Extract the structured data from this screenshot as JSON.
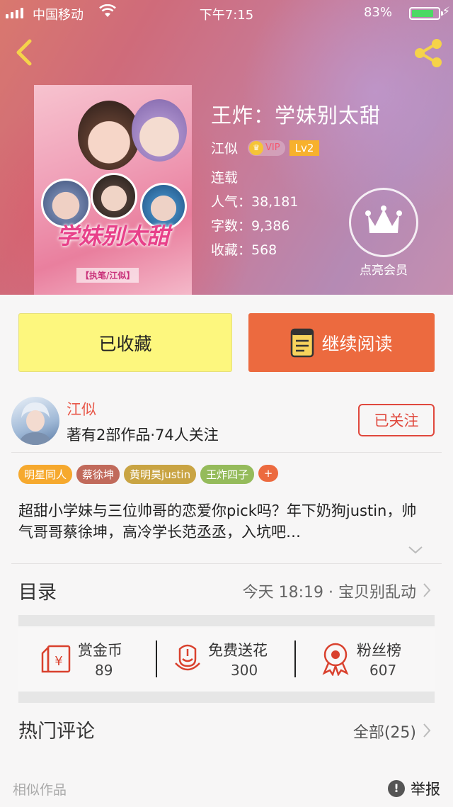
{
  "status_bar": {
    "carrier": "中国移动",
    "time": "下午7:15",
    "battery_percent": "83%",
    "battery_level": 0.83
  },
  "book": {
    "title": "王炸：学妹别太甜",
    "author": "江似",
    "vip_label": "VIP",
    "level": "Lv2",
    "status": "连载",
    "popularity": "人气：38,181",
    "word_count": "字数：9,386",
    "favorites": "收藏：568"
  },
  "cover": {
    "title_art": "学妹别太甜",
    "subtitle": "【执笔/江似】"
  },
  "member": {
    "label": "点亮会员"
  },
  "buttons": {
    "favorited": "已收藏",
    "continue_reading": "继续阅读"
  },
  "author_card": {
    "name": "江似",
    "meta": "著有2部作品·74人关注",
    "follow_label": "已关注"
  },
  "tags": [
    {
      "label": "明星同人",
      "color": "#f6a92e"
    },
    {
      "label": "蔡徐坤",
      "color": "#c16a5b"
    },
    {
      "label": "黄明昊justin",
      "color": "#c9a443"
    },
    {
      "label": "王炸四子",
      "color": "#95bb5b"
    }
  ],
  "tag_add": "+",
  "description": "超甜小学妹与三位帅哥的恋爱你pick吗？年下奶狗justin，帅气哥哥蔡徐坤，高冷学长范丞丞，入坑吧…",
  "toc": {
    "title": "目录",
    "latest": "今天 18:19 · 宝贝别乱动"
  },
  "actions": [
    {
      "label": "赏金币",
      "value": "89",
      "icon": "red-envelope-icon"
    },
    {
      "label": "免费送花",
      "value": "300",
      "icon": "flower-icon"
    },
    {
      "label": "粉丝榜",
      "value": "607",
      "icon": "ribbon-medal-icon"
    }
  ],
  "comments": {
    "title": "热门评论",
    "all_label": "全部(25)"
  },
  "footer": {
    "similar": "相似作品",
    "report": "举报",
    "report_icon": "!"
  },
  "colors": {
    "accent_orange": "#ec6a3f",
    "favorite_yellow": "#fdf77e",
    "follow_red": "#e0483d"
  }
}
